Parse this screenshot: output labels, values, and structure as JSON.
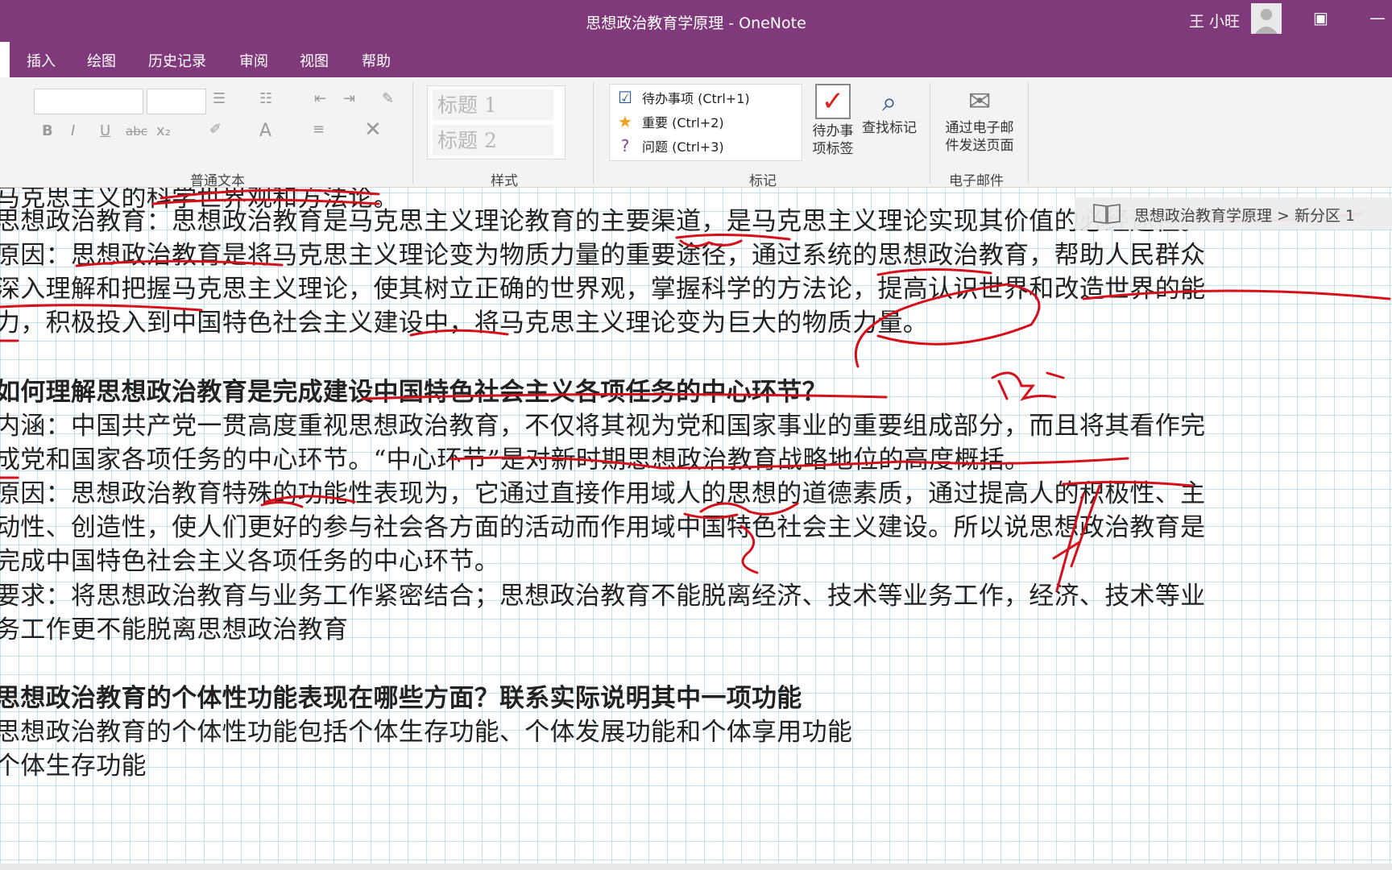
{
  "app": {
    "title": "思想政治教育学原理  -  OneNote",
    "user": "王 小旺",
    "colors": {
      "brand": "#80397b",
      "ink": "#d5101a",
      "grid": "#a6d2e6"
    }
  },
  "ribbon": {
    "tabs": [
      "插入",
      "绘图",
      "历史记录",
      "审阅",
      "视图",
      "帮助"
    ],
    "groups": {
      "basic_text": "普通文本",
      "styles": "样式",
      "tags": "标记",
      "email": "电子邮件"
    },
    "styles": [
      "标题 1",
      "标题 2"
    ],
    "tags": [
      {
        "label": "待办事项 (Ctrl+1)",
        "icon": "checkbox-icon"
      },
      {
        "label": "重要 (Ctrl+2)",
        "icon": "star-icon"
      },
      {
        "label": "问题 (Ctrl+3)",
        "icon": "question-icon"
      }
    ],
    "todo_tag_l1": "待办事",
    "todo_tag_l2": "项标签",
    "find_tags": "查找标记",
    "email_l1": "通过电子邮",
    "email_l2": "件发送页面"
  },
  "breadcrumb": "思想政治教育学原理 > 新分区 1",
  "content": {
    "lines": [
      "马克思主义的科学世界观和方法论。",
      "思想政治教育：思想政治教育是马克思主义理论教育的主要渠道，是马克思主义理论实现其价值的必经途径。",
      "原因：思想政治教育是将马克思主义理论变为物质力量的重要途径，通过系统的思想政治教育，帮助人民群众",
      "深入理解和把握马克思主义理论，使其树立正确的世界观，掌握科学的方法论，提高认识世界和改造世界的能",
      "力，积极投入到中国特色社会主义建设中，将马克思主义理论变为巨大的物质力量。",
      "如何理解思想政治教育是完成建设中国特色社会主义各项任务的中心环节？",
      "内涵：中国共产党一贯高度重视思想政治教育，不仅将其视为党和国家事业的重要组成部分，而且将其看作完",
      "成党和国家各项任务的中心环节。“中心环节”是对新时期思想政治教育战略地位的高度概括。",
      "原因：思想政治教育特殊的功能性表现为，它通过直接作用域人的思想的道德素质，通过提高人的积极性、主",
      "动性、创造性，使人们更好的参与社会各方面的活动而作用域中国特色社会主义建设。所以说思想政治教育是",
      "完成中国特色社会主义各项任务的中心环节。",
      "要求：将思想政治教育与业务工作紧密结合；思想政治教育不能脱离经济、技术等业务工作，经济、技术等业",
      "务工作更不能脱离思想政治教育",
      "思想政治教育的个体性功能表现在哪些方面？联系实际说明其中一项功能",
      "思想政治教育的个体性功能包括个体生存功能、个体发展功能和个体享用功能",
      "个体生存功能"
    ]
  }
}
